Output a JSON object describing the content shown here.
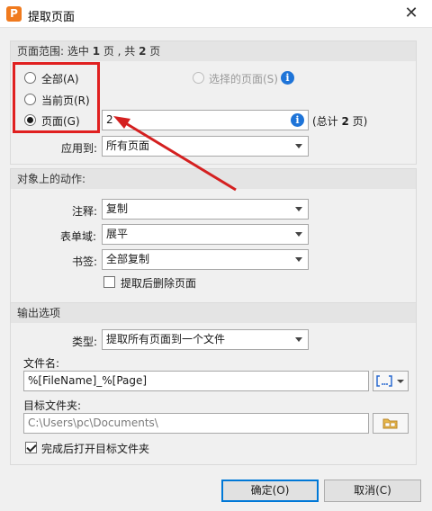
{
  "window": {
    "title": "提取页面",
    "app_icon_letter": "P",
    "close_glyph": "✕"
  },
  "page_range": {
    "header_prefix": "页面范围: 选中 ",
    "header_selected": "1",
    "header_mid": " 页 , 共 ",
    "header_total": "2",
    "header_suffix": " 页",
    "options": {
      "all": "全部(A)",
      "current": "当前页(R)",
      "pages": "页面(G)",
      "selected": "选择的页面(S)"
    },
    "selected_option": "pages",
    "pages_value": "2",
    "total_prefix": "(总计 ",
    "total_value": "2",
    "total_suffix": " 页)",
    "apply_to_label": "应用到:",
    "apply_to_value": "所有页面"
  },
  "actions": {
    "header": "对象上的动作:",
    "annotation_label": "注释:",
    "annotation_value": "复制",
    "form_label": "表单域:",
    "form_value": "展平",
    "bookmark_label": "书签:",
    "bookmark_value": "全部复制",
    "delete_after_label": "提取后删除页面",
    "delete_after_checked": false
  },
  "output": {
    "header": "输出选项",
    "type_label": "类型:",
    "type_value": "提取所有页面到一个文件",
    "filename_label": "文件名:",
    "filename_value": "%[FileName]_%[Page]",
    "folder_label": "目标文件夹:",
    "folder_value": "C:\\Users\\pc\\Documents\\",
    "open_after_label": "完成后打开目标文件夹",
    "open_after_checked": true
  },
  "buttons": {
    "ok": "确定(O)",
    "cancel": "取消(C)"
  },
  "colors": {
    "annotation_red": "#e02020",
    "info_blue": "#1e74d8",
    "default_button_border": "#0078d7"
  }
}
